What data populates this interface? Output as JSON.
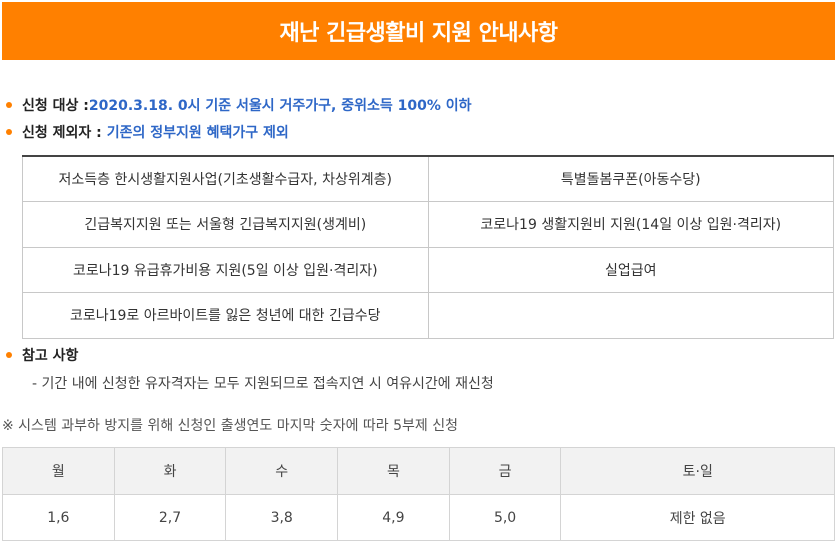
{
  "header": {
    "title": "재난 긴급생활비 지원 안내사항"
  },
  "eligibility": {
    "label": "신청 대상 :",
    "value": "2020.3.18. 0시 기준 서울시 거주가구, 중위소득 100% 이하"
  },
  "exclusion": {
    "label": "신청 제외자 :",
    "value": "기존의 정부지원 혜택가구 제외",
    "rows": [
      [
        "저소득층 한시생활지원사업(기초생활수급자, 차상위계층)",
        "특별돌봄쿠폰(아동수당)"
      ],
      [
        "긴급복지지원 또는 서울형 긴급복지지원(생계비)",
        "코로나19 생활지원비 지원(14일 이상 입원·격리자)"
      ],
      [
        "코로나19 유급휴가비용 지원(5일 이상 입원·격리자)",
        "실업급여"
      ],
      [
        "코로나19로 아르바이트를 잃은 청년에 대한 긴급수당",
        ""
      ]
    ]
  },
  "reference": {
    "label": "참고 사항",
    "note": "- 기간 내에 신청한 유자격자는 모두 지원되므로 접속지연 시 여유시간에 재신청"
  },
  "system_note": "※ 시스템 과부하 방지를 위해 신청인 출생연도 마지막 숫자에 따라 5부제 신청",
  "schedule": {
    "days": [
      "월",
      "화",
      "수",
      "목",
      "금",
      "토·일"
    ],
    "digits": [
      "1,6",
      "2,7",
      "3,8",
      "4,9",
      "5,0",
      "제한 없음"
    ]
  },
  "colors": {
    "accent": "#ff8000",
    "highlight": "#2e67c7"
  }
}
